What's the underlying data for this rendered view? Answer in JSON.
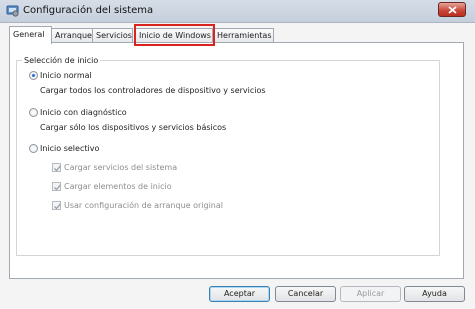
{
  "window": {
    "title": "Configuración del sistema"
  },
  "tabs": [
    {
      "label": "General",
      "selected": true
    },
    {
      "label": "Arranque"
    },
    {
      "label": "Servicios"
    },
    {
      "label": "Inicio de Windows",
      "highlighted": true
    },
    {
      "label": "Herramientas"
    }
  ],
  "group": {
    "legend": "Selección de inicio",
    "options": [
      {
        "label": "Inicio normal",
        "description": "Cargar todos los controladores de dispositivo y servicios",
        "selected": true
      },
      {
        "label": "Inicio con diagnóstico",
        "description": "Cargar sólo los dispositivos y servicios básicos",
        "selected": false
      },
      {
        "label": "Inicio selectivo",
        "selected": false
      }
    ],
    "selective_items": [
      {
        "label": "Cargar servicios del sistema",
        "checked": true,
        "enabled": false
      },
      {
        "label": "Cargar elementos de inicio",
        "checked": true,
        "enabled": false
      },
      {
        "label": "Usar configuración de arranque original",
        "checked": true,
        "enabled": false
      }
    ]
  },
  "buttons": {
    "ok": "Aceptar",
    "cancel": "Cancelar",
    "apply": "Aplicar",
    "help": "Ayuda"
  },
  "colors": {
    "highlight": "#d9231e",
    "radio_dot": "#2a6fd0",
    "disabled_text": "#8e8e8e"
  }
}
